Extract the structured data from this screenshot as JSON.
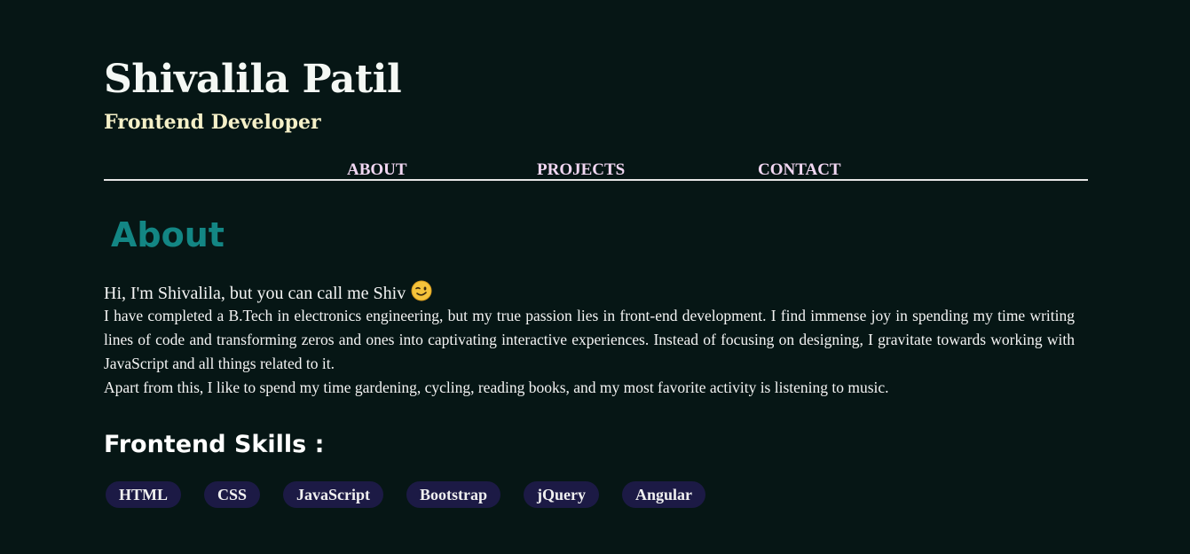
{
  "header": {
    "name": "Shivalila Patil",
    "role": "Frontend Developer"
  },
  "nav": {
    "items": [
      {
        "label": "ABOUT"
      },
      {
        "label": "PROJECTS"
      },
      {
        "label": "CONTACT"
      }
    ]
  },
  "about": {
    "title": "About",
    "greeting": "Hi, I'm Shivalila, but you can call me Shiv",
    "greeting_emoji": "😉",
    "bio": "I have completed a B.Tech in electronics engineering, but my true passion lies in front-end development. I find immense joy in spending my time writing lines of code and transforming zeros and ones into captivating interactive experiences. Instead of focusing on designing, I gravitate towards working with JavaScript and all things related to it.",
    "hobbies": "Apart from this, I like to spend my time gardening, cycling, reading books, and my most favorite activity is listening to music."
  },
  "skills": {
    "title": "Frontend Skills :",
    "items": [
      "HTML",
      "CSS",
      "JavaScript",
      "Bootstrap",
      "jQuery",
      "Angular"
    ]
  },
  "colors": {
    "background": "#061615",
    "name": "#f4f8f4",
    "role": "#f5f0c8",
    "nav_link": "#f1d7f2",
    "section_title": "#138684",
    "skill_chip": "#1c1a45"
  }
}
